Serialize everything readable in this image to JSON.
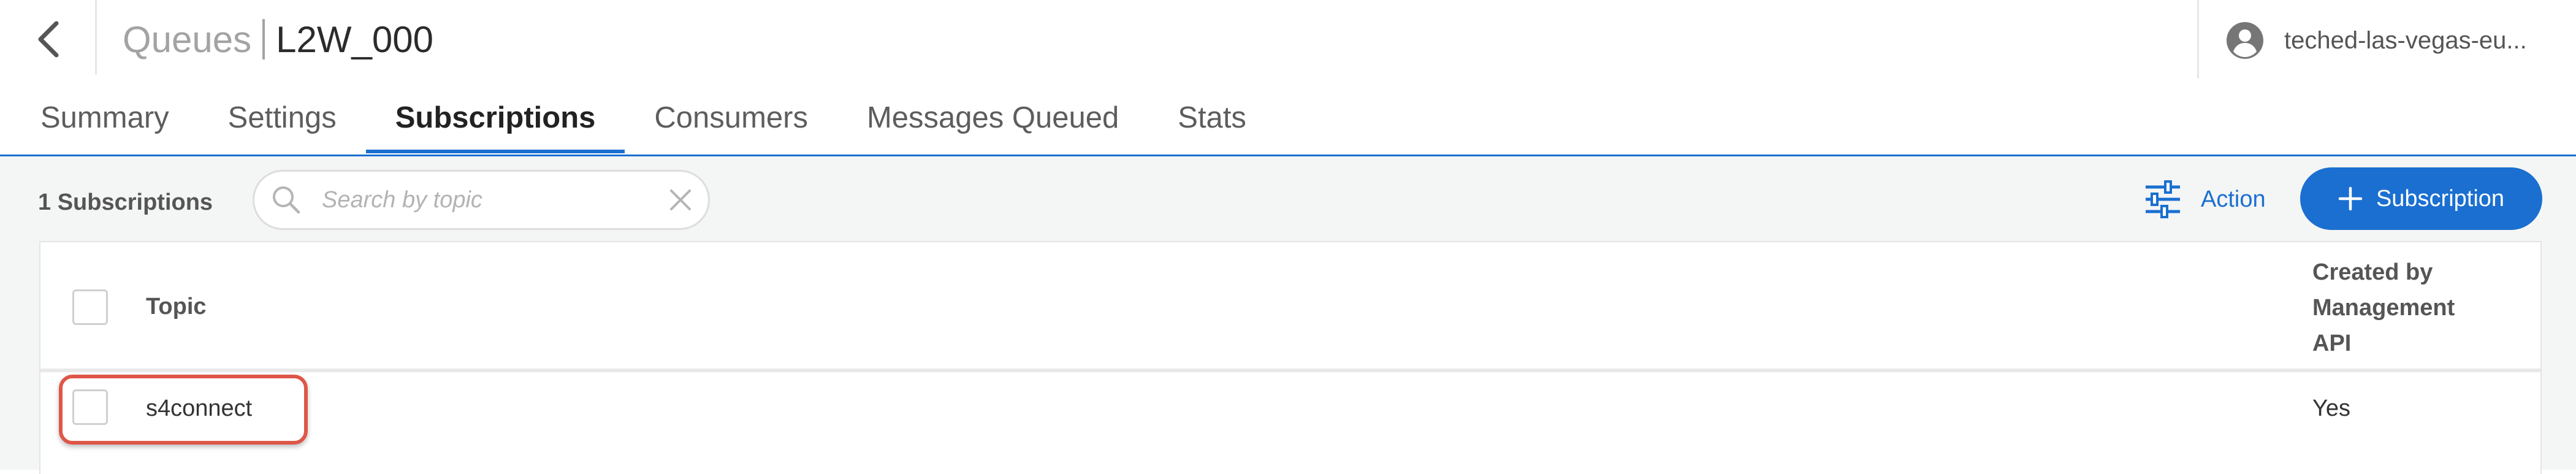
{
  "header": {
    "back_icon": "chevron-left-icon",
    "breadcrumb_parent": "Queues",
    "breadcrumb_current": "L2W_000",
    "user": {
      "avatar_icon": "account-circle-icon",
      "name": "teched-las-vegas-eu..."
    }
  },
  "tabs": [
    {
      "label": "Summary",
      "active": false
    },
    {
      "label": "Settings",
      "active": false
    },
    {
      "label": "Subscriptions",
      "active": true
    },
    {
      "label": "Consumers",
      "active": false
    },
    {
      "label": "Messages Queued",
      "active": false
    },
    {
      "label": "Stats",
      "active": false
    }
  ],
  "toolbar": {
    "count_label": "1 Subscriptions",
    "search": {
      "placeholder": "Search by topic",
      "value": "",
      "icon": "search-icon",
      "clear_icon": "close-icon"
    },
    "action": {
      "label": "Action",
      "icon": "sliders-icon"
    },
    "add_subscription": {
      "label": "Subscription",
      "icon": "plus-icon"
    }
  },
  "table": {
    "columns": [
      "Topic",
      "Created by Management API"
    ],
    "rows": [
      {
        "topic": "s4connect",
        "created_by_management_api": "Yes",
        "highlighted": true
      }
    ]
  },
  "colors": {
    "accent": "#1a6fd1",
    "highlight": "#de5648",
    "content_bg": "#f4f5f5"
  }
}
